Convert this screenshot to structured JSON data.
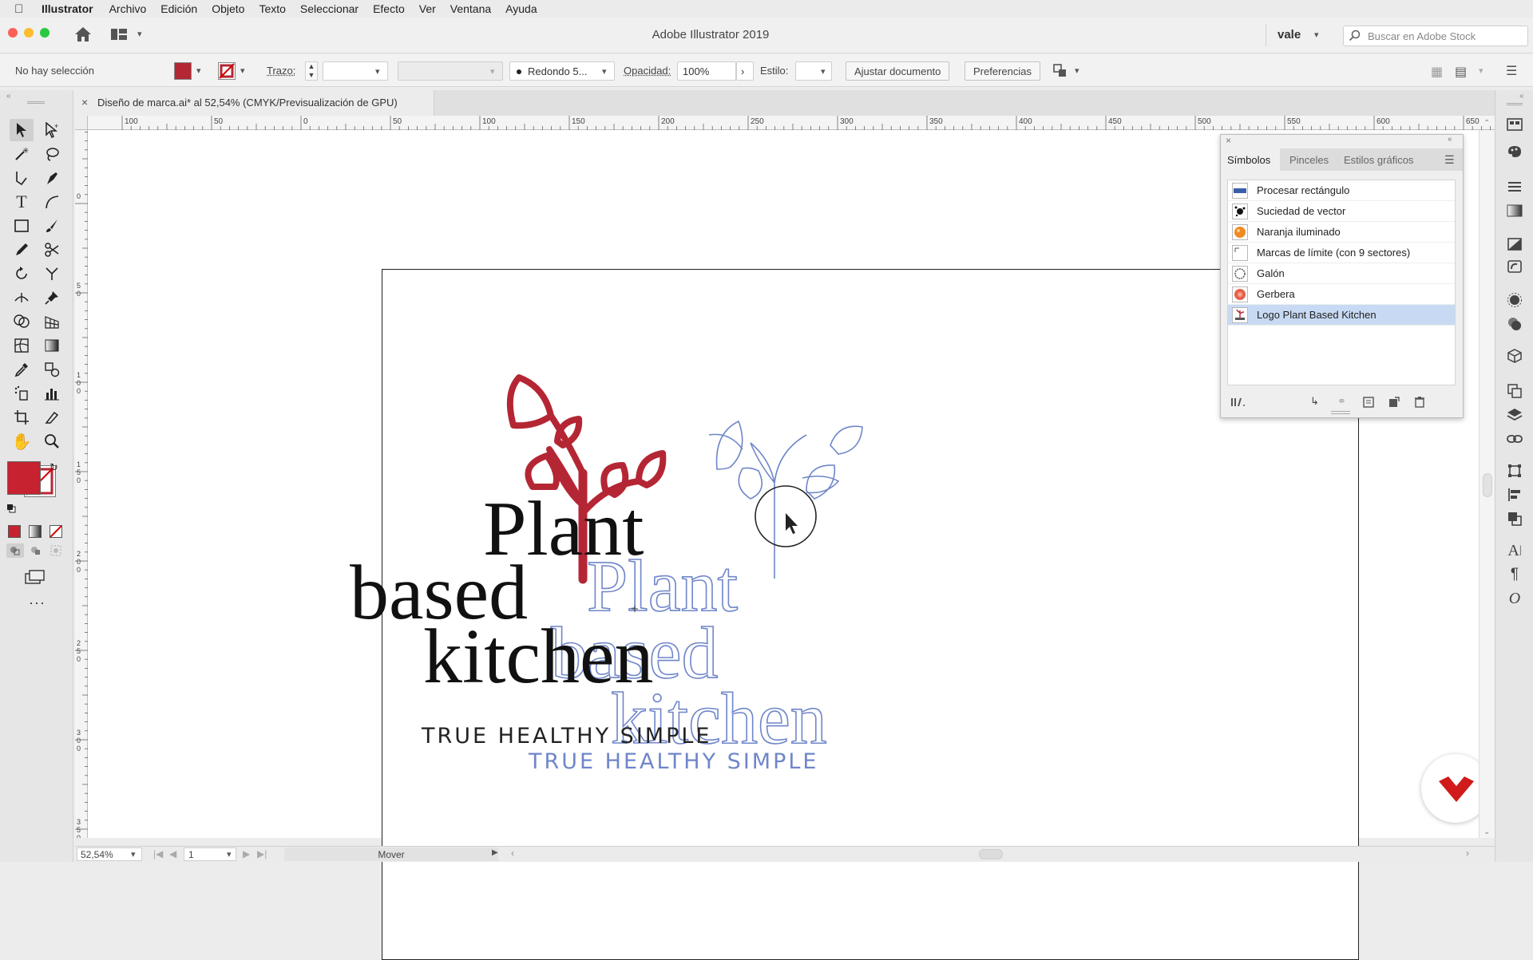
{
  "menubar": {
    "apple": "",
    "items": [
      "Illustrator",
      "Archivo",
      "Edición",
      "Objeto",
      "Texto",
      "Seleccionar",
      "Efecto",
      "Ver",
      "Ventana",
      "Ayuda"
    ]
  },
  "appbar": {
    "title": "Adobe Illustrator 2019",
    "workspace": "vale",
    "stock_placeholder": "Buscar en Adobe Stock"
  },
  "control": {
    "selection": "No hay selección",
    "stroke_label": "Trazo:",
    "brush": "Redondo 5...",
    "opacity_label": "Opacidad:",
    "opacity_value": "100%",
    "style_label": "Estilo:",
    "adjust_button": "Ajustar documento",
    "prefs_button": "Preferencias"
  },
  "document": {
    "tab_title": "Diseño de marca.ai* al 52,54% (CMYK/Previsualización de GPU)"
  },
  "rulers": {
    "top": [
      "100",
      "50",
      "0",
      "50",
      "100",
      "150",
      "200",
      "250",
      "300",
      "350",
      "400",
      "450",
      "500",
      "550",
      "600",
      "650"
    ],
    "left": [
      "0",
      "5\n0",
      "1\n0\n0",
      "1\n5\n0",
      "2\n0\n0",
      "2\n5\n0",
      "3\n0\n0",
      "3\n5\n0"
    ]
  },
  "artwork": {
    "logo_line1": "Plant",
    "logo_line2": "based",
    "logo_line3": "kitchen",
    "tagline": "TRUE HEALTHY SIMPLE",
    "brand_red": "#b52634",
    "outline_blue": "#6f86c9"
  },
  "symbols_panel": {
    "tabs": [
      "Símbolos",
      "Pinceles",
      "Estilos gráficos"
    ],
    "items": [
      {
        "name": "Procesar rectángulo"
      },
      {
        "name": "Suciedad de vector"
      },
      {
        "name": "Naranja iluminado"
      },
      {
        "name": "Marcas de límite (con 9 sectores)"
      },
      {
        "name": "Galón"
      },
      {
        "name": "Gerbera"
      },
      {
        "name": "Logo Plant Based Kitchen"
      }
    ],
    "selected_index": 6
  },
  "statusbar": {
    "zoom": "52,54%",
    "artboard": "1",
    "status": "Mover"
  }
}
